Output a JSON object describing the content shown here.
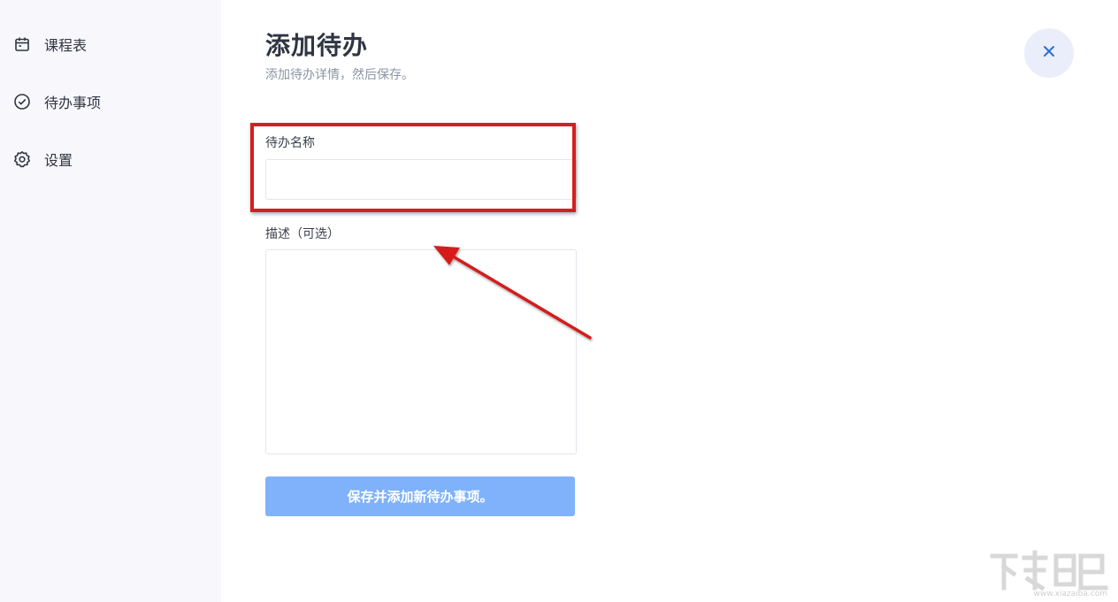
{
  "sidebar": {
    "items": [
      {
        "label": "课程表",
        "icon": "calendar-icon"
      },
      {
        "label": "待办事项",
        "icon": "check-circle-icon"
      },
      {
        "label": "设置",
        "icon": "gear-icon"
      }
    ]
  },
  "main": {
    "title": "添加待办",
    "subtitle": "添加待办详情，然后保存。",
    "close_icon": "close-icon"
  },
  "form": {
    "name_label": "待办名称",
    "name_value": "",
    "description_label": "描述（可选）",
    "description_value": "",
    "submit_label": "保存并添加新待办事项。"
  },
  "watermark": {
    "url": "www.xiazaiba.com"
  },
  "colors": {
    "accent": "#7fb2fb",
    "close_bg": "#e9eefa",
    "close_icon": "#2b6fd6",
    "annotation": "#d51f1f",
    "sidebar_bg": "#f8f7fb"
  }
}
